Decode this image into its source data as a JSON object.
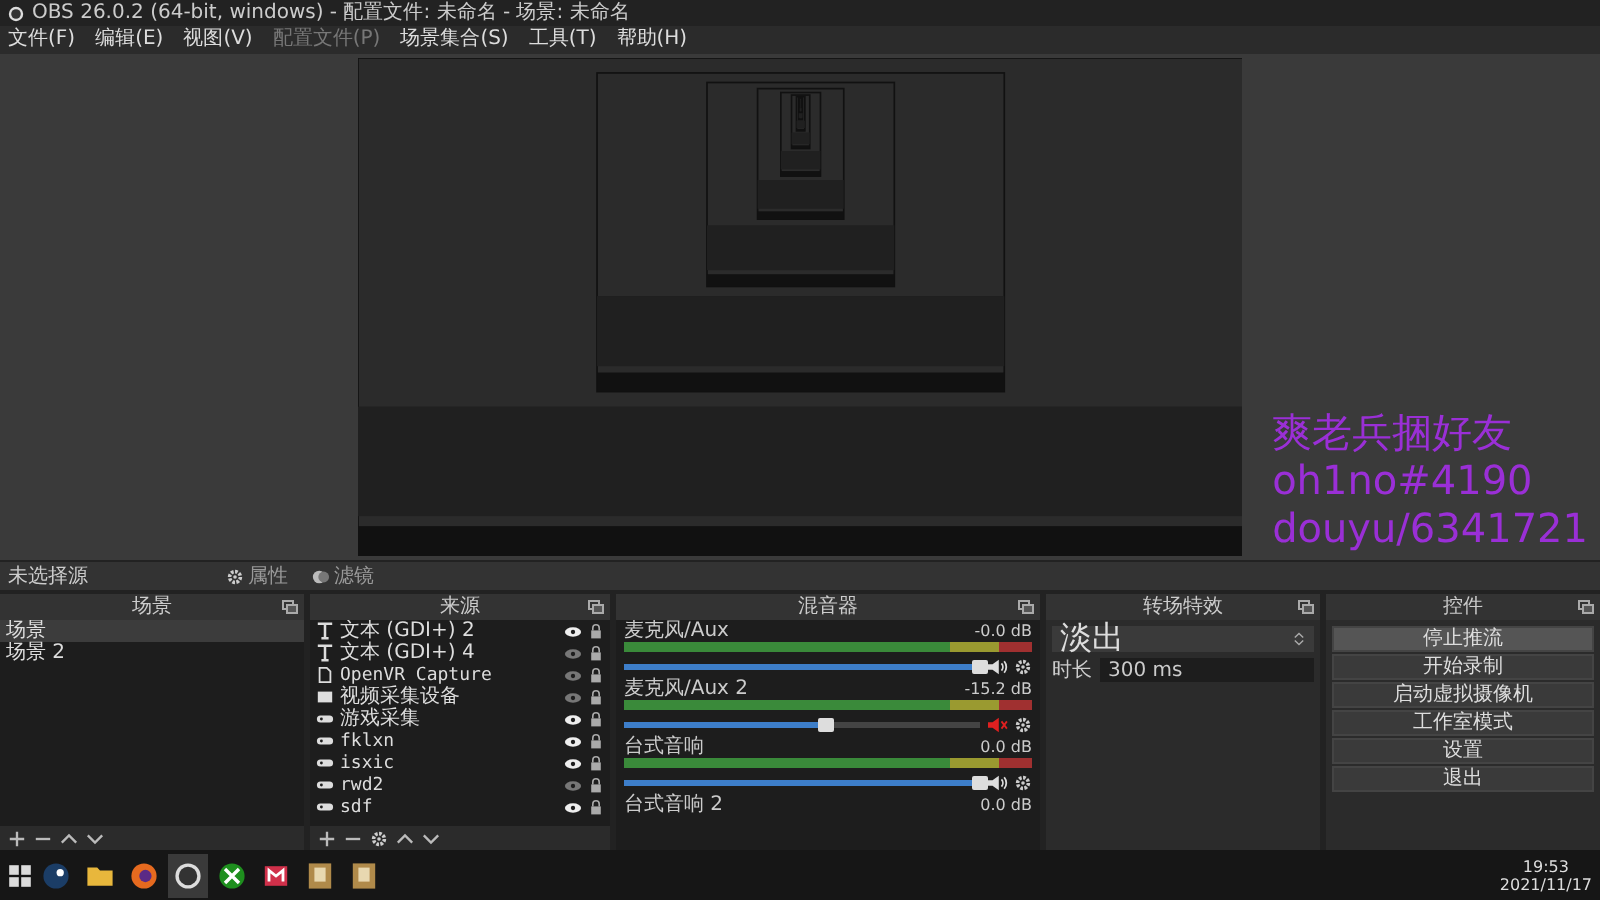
{
  "window": {
    "title": "OBS 26.0.2 (64-bit, windows) - 配置文件: 未命名 - 场景: 未命名"
  },
  "menu": [
    {
      "label": "文件(F)",
      "disabled": false
    },
    {
      "label": "编辑(E)",
      "disabled": false
    },
    {
      "label": "视图(V)",
      "disabled": false
    },
    {
      "label": "配置文件(P)",
      "disabled": true
    },
    {
      "label": "场景集合(S)",
      "disabled": false
    },
    {
      "label": "工具(T)",
      "disabled": false
    },
    {
      "label": "帮助(H)",
      "disabled": false
    }
  ],
  "source_toolbar": {
    "label": "未选择源",
    "buttons": [
      {
        "kind": "gear",
        "label": "属性"
      },
      {
        "kind": "filter",
        "label": "滤镜"
      }
    ]
  },
  "scenes": {
    "title": "场景",
    "items": [
      {
        "label": "场景",
        "selected": true
      },
      {
        "label": "场景 2",
        "selected": false
      }
    ]
  },
  "sources": {
    "title": "来源",
    "items": [
      {
        "kind": "text",
        "label": "文本 (GDI+) 2",
        "visible": true
      },
      {
        "kind": "text",
        "label": "文本 (GDI+) 4",
        "visible": false
      },
      {
        "kind": "file",
        "label": "OpenVR Capture",
        "visible": false
      },
      {
        "kind": "camera",
        "label": "视频采集设备",
        "visible": false
      },
      {
        "kind": "game",
        "label": "游戏采集",
        "visible": true
      },
      {
        "kind": "game",
        "label": "fklxn",
        "visible": true
      },
      {
        "kind": "game",
        "label": "isxic",
        "visible": true
      },
      {
        "kind": "game",
        "label": "rwd2",
        "visible": false
      },
      {
        "kind": "game",
        "label": "sdf",
        "visible": true
      }
    ]
  },
  "mixer": {
    "title": "混音器",
    "tracks": [
      {
        "name": "麦克风/Aux",
        "reading": "-0.0 dB",
        "level": 1,
        "muted": false
      },
      {
        "name": "麦克风/Aux 2",
        "reading": "-15.2 dB",
        "level": 0.57,
        "muted": true
      },
      {
        "name": "台式音响",
        "reading": "0.0 dB",
        "level": 1,
        "muted": false
      },
      {
        "name": "台式音响 2",
        "reading": "0.0 dB"
      }
    ]
  },
  "transitions": {
    "title": "转场特效",
    "transition": "淡出",
    "duration_label": "时长",
    "duration": "300 ms"
  },
  "controls": {
    "title": "控件",
    "buttons": [
      {
        "label": "停止推流",
        "active": true
      },
      {
        "label": "开始录制",
        "active": false
      },
      {
        "label": "启动虚拟摄像机",
        "active": false
      },
      {
        "label": "工作室模式",
        "active": false
      },
      {
        "label": "设置",
        "active": false
      },
      {
        "label": "退出",
        "active": false
      }
    ]
  },
  "overlay_text": [
    "爽老兵捆好友",
    "oh1no#4190",
    "douyu/6341721"
  ],
  "taskbar": {
    "apps": [
      {
        "kind": "steam",
        "selected": false
      },
      {
        "kind": "folder",
        "selected": false
      },
      {
        "kind": "browser",
        "selected": false
      },
      {
        "kind": "obs",
        "selected": true
      },
      {
        "kind": "xbox",
        "selected": false
      },
      {
        "kind": "app",
        "selected": false
      },
      {
        "kind": "game",
        "selected": false
      },
      {
        "kind": "game",
        "selected": false
      }
    ],
    "time": "19:53",
    "date": "2021/11/17"
  }
}
